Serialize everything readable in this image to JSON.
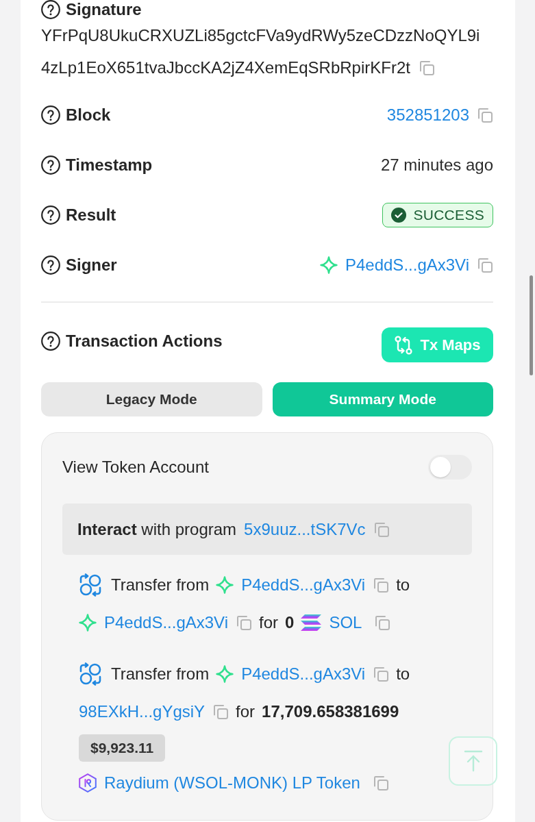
{
  "signature": {
    "label": "Signature",
    "lines": [
      "YFrPqU8UkuCRXUZLi85gctcFVa9ydRWy5zeCDzzNoQYL9i",
      "4zLp1EoX651tvaJbccKA2jZ4XemEqSRbRpirKFr2t"
    ],
    "copyable": true
  },
  "details": [
    {
      "label": "Block",
      "kind": "link",
      "value": "352851203",
      "copyable": true
    },
    {
      "label": "Timestamp",
      "kind": "text",
      "value": "27 minutes ago"
    },
    {
      "label": "Result",
      "kind": "status",
      "value": "SUCCESS"
    },
    {
      "label": "Signer",
      "kind": "wallet",
      "value": "P4eddS...gAx3Vi",
      "copyable": true
    }
  ],
  "transaction_actions": {
    "title": "Transaction Actions",
    "button": "Tx Maps"
  },
  "modes": [
    {
      "label": "Legacy Mode",
      "selected": false
    },
    {
      "label": "Summary Mode",
      "selected": true
    }
  ],
  "summary": {
    "view_token_account": {
      "label": "View Token Account",
      "on": false
    },
    "interaction": {
      "text": "**Interact** with program",
      "program": "5x9uuz...tSK7Vc",
      "copyable": true
    },
    "transfers": [
      {
        "text": "Transfer from",
        "from": {
          "kind": "wallet",
          "address": "P4eddS...gAx3Vi",
          "copyable": true
        },
        "to_text": "to",
        "to": {
          "kind": "wallet",
          "address": "P4eddS...gAx3Vi",
          "copyable": true
        },
        "for_text": "for",
        "amount": "0",
        "token": {
          "kind": "sol",
          "name": "SOL",
          "copyable": true
        }
      },
      {
        "text": "Transfer from",
        "from": {
          "kind": "wallet",
          "address": "P4eddS...gAx3Vi",
          "copyable": true
        },
        "to_text": "to",
        "to": {
          "kind": "account",
          "address": "98EXkH...gYgsiY",
          "copyable": true
        },
        "for_text": "for",
        "amount": "17,709.658381699",
        "usd": "$9,923.11",
        "token": {
          "kind": "raydium",
          "name": "Raydium (WSOL-MONK) LP Token",
          "copyable": true
        }
      }
    ]
  }
}
